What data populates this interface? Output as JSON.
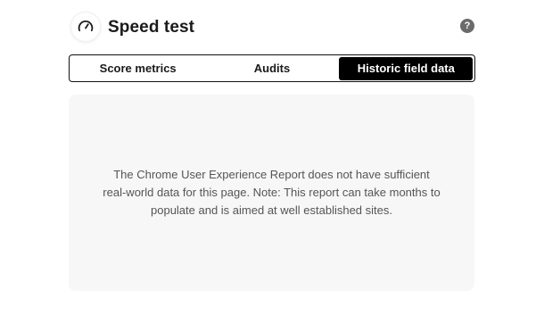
{
  "header": {
    "title": "Speed test",
    "icon": "speedometer-icon",
    "help_icon": "help-icon",
    "help_glyph": "?"
  },
  "tabs": [
    {
      "label": "Score metrics",
      "active": false
    },
    {
      "label": "Audits",
      "active": false
    },
    {
      "label": "Historic field data",
      "active": true
    }
  ],
  "content": {
    "message": "The Chrome User Experience Report does not have sufficient real-world data for this page. Note: This report can take months to populate and is aimed at well established sites."
  },
  "colors": {
    "active_tab_bg": "#000000",
    "active_tab_text": "#ffffff",
    "content_bg": "#f7f7f7",
    "message_text": "#555555",
    "help_icon_bg": "#6b6b6b"
  }
}
